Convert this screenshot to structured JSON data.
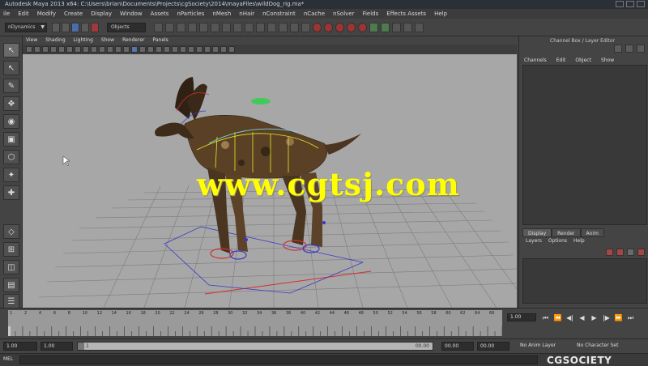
{
  "window": {
    "title": "Autodesk Maya 2013 x64: C:\\Users\\brian\\Documents\\Projects\\cgSociety\\2014\\mayaFiles\\wildDog_rig.ma*"
  },
  "menubar": [
    "ile",
    "Edit",
    "Modify",
    "Create",
    "Display",
    "Window",
    "Assets",
    "nParticles",
    "nMesh",
    "nHair",
    "nConstraint",
    "nCache",
    "nSolver",
    "Fields",
    "Effects Assets",
    "Help"
  ],
  "statusline": {
    "mode": "nDynamics",
    "objects_label": "Objects"
  },
  "panel": {
    "menu": [
      "View",
      "Shading",
      "Lighting",
      "Show",
      "Renderer",
      "Panels"
    ]
  },
  "viewport": {
    "watermark": "www.cgtsj.com",
    "background": "#a7a7a7",
    "grid_color": "#7c7c7c"
  },
  "channelbox": {
    "title": "Channel Box / Layer Editor",
    "tabs": [
      "Channels",
      "Edit",
      "Object",
      "Show"
    ]
  },
  "layereditor": {
    "tabs": [
      "Display",
      "Render",
      "Anim"
    ],
    "menu": [
      "Layers",
      "Options",
      "Help"
    ]
  },
  "timeslider": {
    "labels": [
      "1",
      "2",
      "4",
      "6",
      "8",
      "10",
      "12",
      "14",
      "16",
      "18",
      "20",
      "22",
      "24",
      "26",
      "28",
      "30",
      "32",
      "34",
      "36",
      "38",
      "40",
      "42",
      "44",
      "46",
      "48",
      "50",
      "52",
      "54",
      "56",
      "58",
      "60",
      "62",
      "64",
      "66"
    ],
    "current_frame": "1.00",
    "controls": [
      "⏮",
      "⏪",
      "◀|",
      "◀",
      "▶",
      "|▶",
      "⏩",
      "⏭"
    ]
  },
  "rangeslider": {
    "start": "1.00",
    "inner_start": "1.00",
    "range_start_label": "1",
    "range_end_label": "00.00",
    "end": "00.00",
    "no_anim_layer": "No Anim Layer",
    "no_char_set": "No Character Set"
  },
  "cmdline": {
    "label": "MEL",
    "logo": "CGSOCIETY"
  }
}
